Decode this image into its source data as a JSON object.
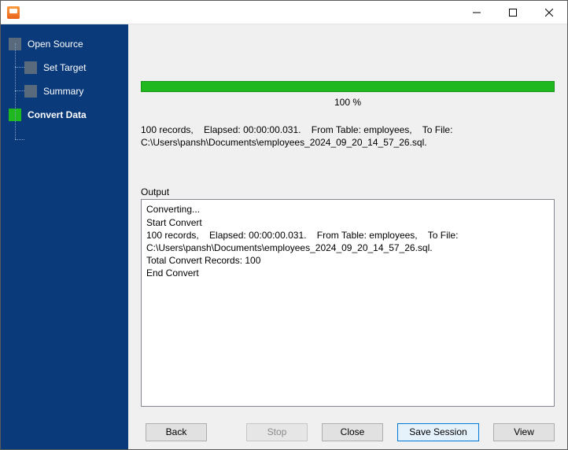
{
  "sidebar": {
    "steps": [
      {
        "label": "Open Source",
        "active": false,
        "child": false
      },
      {
        "label": "Set Target",
        "active": false,
        "child": true
      },
      {
        "label": "Summary",
        "active": false,
        "child": true
      },
      {
        "label": "Convert Data",
        "active": true,
        "child": false
      }
    ]
  },
  "progress": {
    "percent_label": "100 %"
  },
  "summary_text": "100 records,    Elapsed: 00:00:00.031.    From Table: employees,    To File: C:\\Users\\pansh\\Documents\\employees_2024_09_20_14_57_26.sql.",
  "output": {
    "label": "Output",
    "text": "Converting...\nStart Convert\n100 records,    Elapsed: 00:00:00.031.    From Table: employees,    To File: C:\\Users\\pansh\\Documents\\employees_2024_09_20_14_57_26.sql.\nTotal Convert Records: 100\nEnd Convert"
  },
  "buttons": {
    "back": "Back",
    "stop": "Stop",
    "close": "Close",
    "save_session": "Save Session",
    "view": "View"
  }
}
